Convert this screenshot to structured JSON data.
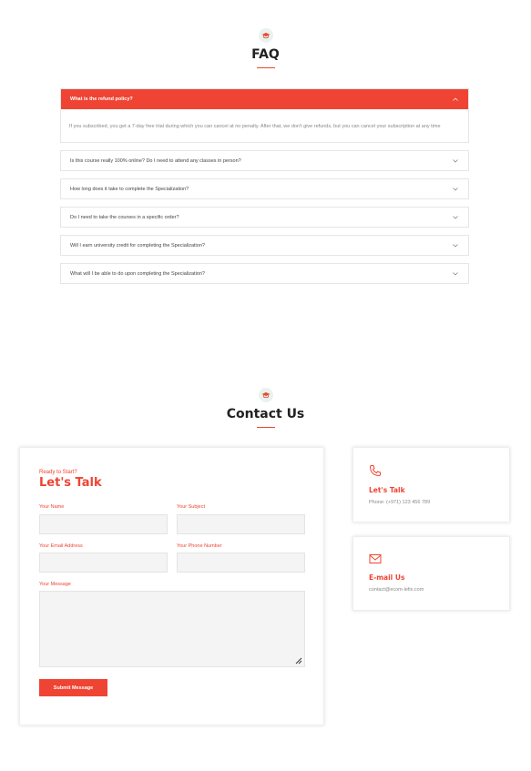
{
  "faq": {
    "title": "FAQ",
    "items": [
      {
        "question": "What is the refund policy?",
        "answer": "If you subscribed, you get a 7-day free trial during which you can cancel at no penalty. After that, we don't give refunds, but you can cancel your subscription at any time",
        "open": true
      },
      {
        "question": "Is this course really 100% online? Do I need to attend any classes in person?",
        "open": false
      },
      {
        "question": "How long does it take to complete the Specialization?",
        "open": false
      },
      {
        "question": "Do I need to take the courses in a specific order?",
        "open": false
      },
      {
        "question": "Will I earn university credit for completing the Specialization?",
        "open": false
      },
      {
        "question": "What will I be able to do upon completing the Specialization?",
        "open": false
      }
    ]
  },
  "contact": {
    "title": "Contact Us",
    "form": {
      "kicker": "Ready to Start?",
      "heading": "Let's Talk",
      "name_label": "Your Name",
      "subject_label": "Your Subject",
      "email_label": "Your Email Address",
      "phone_label": "Your Phone Number",
      "message_label": "Your Message",
      "submit_label": "Submit Message"
    },
    "cards": {
      "phone": {
        "title": "Let's Talk",
        "text": "Phone: (+971) 123 456 789",
        "icon": "phone-icon"
      },
      "email": {
        "title": "E-mail Us",
        "text": "contact@ecom-lefix.com",
        "icon": "mail-icon"
      }
    }
  },
  "colors": {
    "accent": "#ef4433",
    "icon_bg": "#e8f3ee",
    "input_bg": "#f4f4f4"
  }
}
